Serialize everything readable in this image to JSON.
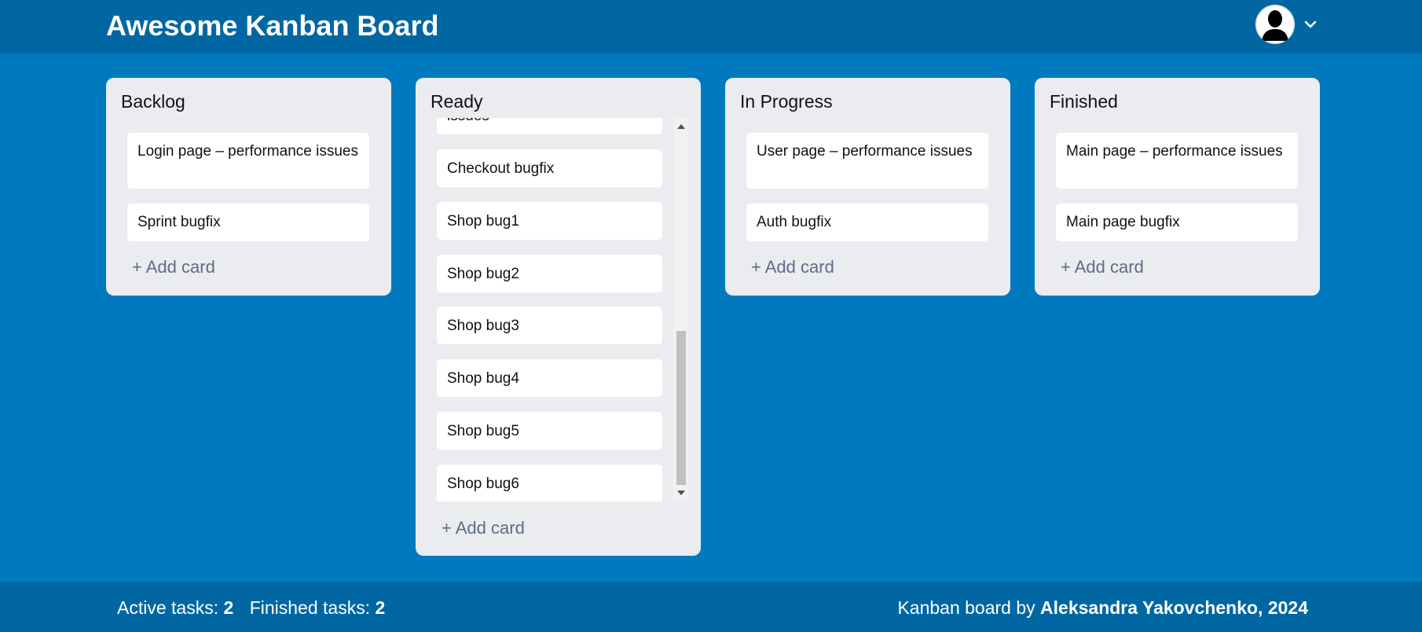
{
  "header": {
    "title": "Awesome Kanban Board",
    "avatar_icon": "user-silhouette-icon",
    "menu_icon": "chevron-down-icon"
  },
  "columns": [
    {
      "title": "Backlog",
      "cards": [
        "Login page – performance issues",
        "Sprint bugfix"
      ],
      "add_label": "+ Add card"
    },
    {
      "title": "Ready",
      "cards": [
        "issues",
        "Checkout bugfix",
        "Shop bug1",
        "Shop bug2",
        "Shop bug3",
        "Shop bug4",
        "Shop bug5",
        "Shop bug6"
      ],
      "add_label": "+ Add card"
    },
    {
      "title": "In Progress",
      "cards": [
        "User page – performance issues",
        "Auth bugfix"
      ],
      "add_label": "+ Add card"
    },
    {
      "title": "Finished",
      "cards": [
        "Main page – performance issues",
        "Main page bugfix"
      ],
      "add_label": "+ Add card"
    }
  ],
  "footer": {
    "active_label": "Active tasks:",
    "active_count": "2",
    "finished_label": "Finished tasks:",
    "finished_count": "2",
    "credit_prefix": "Kanban board by",
    "credit_author": "Aleksandra Yakovchenko",
    "credit_year": ", 2024"
  },
  "colors": {
    "background": "#0079bf",
    "header": "#0067a3",
    "column": "#ebecf0",
    "card": "#ffffff",
    "add_card_text": "#5e6c84"
  }
}
